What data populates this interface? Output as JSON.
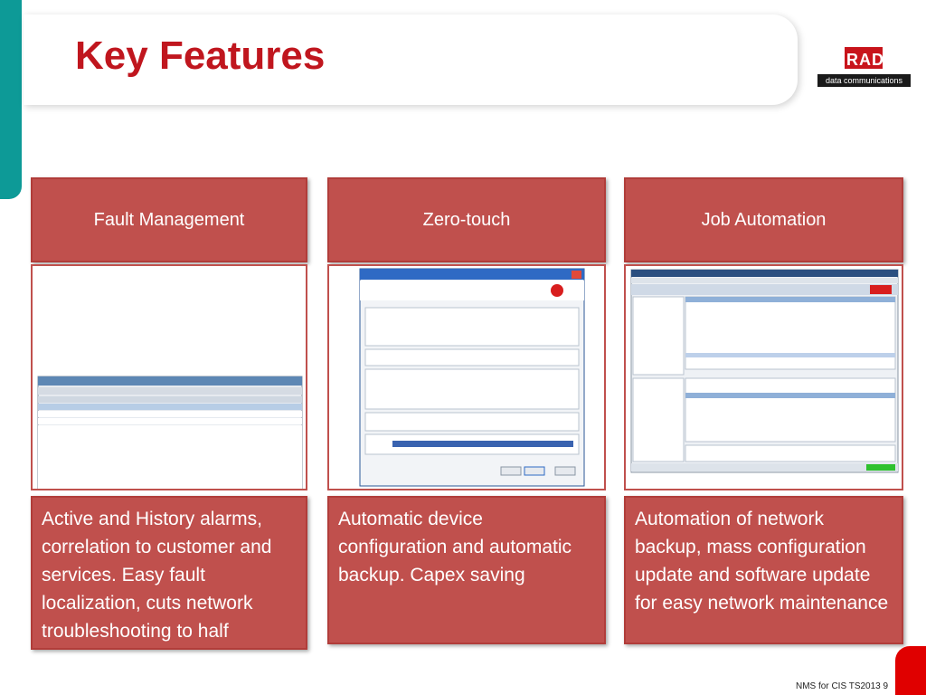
{
  "slide": {
    "title": "Key Features",
    "footer_text": "NMS for CIS TS2013",
    "page_number": "9"
  },
  "logo": {
    "brand": "RAD",
    "tagline": "data communications"
  },
  "colors": {
    "accent_red": "#c0504d",
    "title_red": "#c0161e",
    "teal": "#0d9a97"
  },
  "features": [
    {
      "title": "Fault Management",
      "description": "Active and History alarms, correlation to customer and services. Easy fault localization, cuts network troubleshooting to half"
    },
    {
      "title": "Zero-touch",
      "description": "Automatic device configuration and automatic backup. Capex saving"
    },
    {
      "title": "Job Automation",
      "description": "Automation of network backup, mass configuration update and software update for easy network maintenance"
    }
  ]
}
